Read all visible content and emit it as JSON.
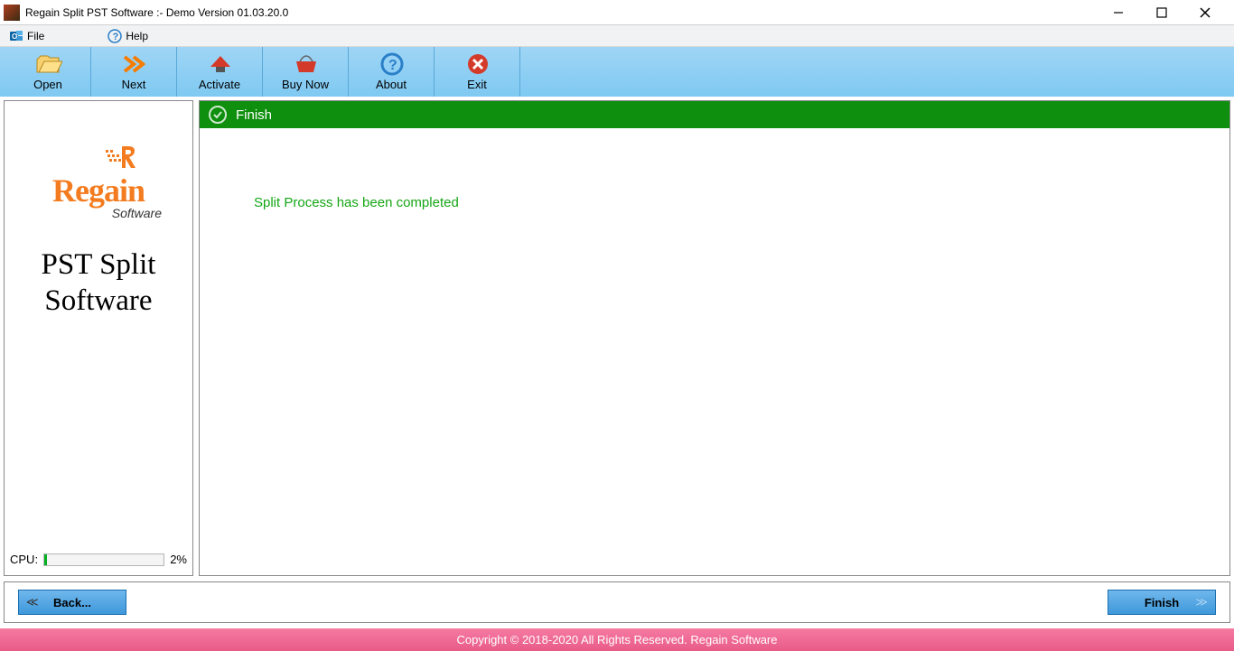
{
  "window": {
    "title": "Regain Split PST Software :- Demo Version 01.03.20.0"
  },
  "menu": {
    "file": "File",
    "help": "Help"
  },
  "toolbar": {
    "open": "Open",
    "next": "Next",
    "activate": "Activate",
    "buy_now": "Buy Now",
    "about": "About",
    "exit": "Exit"
  },
  "sidebar": {
    "brand_top": "Regain",
    "brand_sub": "Software",
    "product_line1": "PST Split",
    "product_line2": "Software",
    "cpu_label": "CPU:",
    "cpu_percent_text": "2%",
    "cpu_percent_value": 2
  },
  "main": {
    "finish_header": "Finish",
    "result_message": "Split Process has been completed"
  },
  "nav": {
    "back": "Back...",
    "finish": "Finish"
  },
  "footer": {
    "copyright": "Copyright © 2018-2020 All Rights Reserved. Regain Software"
  }
}
